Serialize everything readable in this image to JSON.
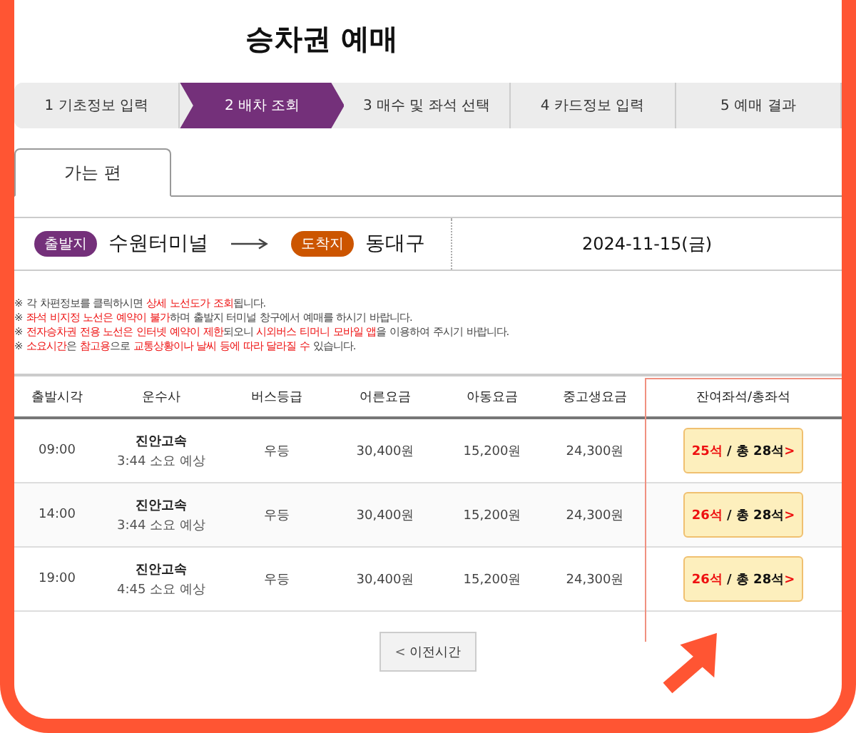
{
  "title": "승차권 예매",
  "steps": [
    {
      "label": "1 기초정보 입력",
      "selected": false
    },
    {
      "label": "2 배차 조회",
      "selected": true
    },
    {
      "label": "3 매수 및 좌석 선택",
      "selected": false
    },
    {
      "label": "4 카드정보 입력",
      "selected": false
    },
    {
      "label": "5 예매 결과",
      "selected": false
    }
  ],
  "tabs": [
    {
      "label": "가는 편",
      "selected": true
    }
  ],
  "route": {
    "departure_badge": "출발지",
    "departure": "수원터미널",
    "arrival_badge": "도착지",
    "arrival": "동대구",
    "date": "2024-11-15(금)"
  },
  "notes": [
    [
      {
        "text": "※ 각 차편정보를 클릭하시면 ",
        "red": false
      },
      {
        "text": "상세 노선도가 조회",
        "red": true
      },
      {
        "text": "됩니다.",
        "red": false
      }
    ],
    [
      {
        "text": "※ ",
        "red": false
      },
      {
        "text": "좌석 비지정 노선은 예약이 불가",
        "red": true
      },
      {
        "text": "하며 출발지 터미널 창구에서 예매를 하시기 바랍니다.",
        "red": false
      }
    ],
    [
      {
        "text": "※ ",
        "red": false
      },
      {
        "text": "전자승차권 전용 노선은 인터넷 예약이 제한",
        "red": true
      },
      {
        "text": "되오니 ",
        "red": false
      },
      {
        "text": "시외버스 티머니 모바일 앱",
        "red": true
      },
      {
        "text": "을 이용하여 주시기 바랍니다.",
        "red": false
      }
    ],
    [
      {
        "text": "※ ",
        "red": false
      },
      {
        "text": "소요시간",
        "red": true
      },
      {
        "text": "은 ",
        "red": false
      },
      {
        "text": "참고용",
        "red": true
      },
      {
        "text": "으로 ",
        "red": false
      },
      {
        "text": "교통상황이나 날씨 등에 따라 달라질 수",
        "red": true
      },
      {
        "text": " 있습니다.",
        "red": false
      }
    ]
  ],
  "table": {
    "columns": [
      "출발시각",
      "운수사",
      "버스등급",
      "어른요금",
      "아동요금",
      "중고생요금",
      "잔여좌석/총좌석"
    ],
    "rows": [
      {
        "time": "09:00",
        "company": "진안고속",
        "duration": "3:44 소요 예상",
        "grade": "우등",
        "adult": "30,400원",
        "child": "15,200원",
        "student": "24,300원",
        "remaining": "25석",
        "total": " / 총 28석",
        "chevron": ">"
      },
      {
        "time": "14:00",
        "company": "진안고속",
        "duration": "3:44 소요 예상",
        "grade": "우등",
        "adult": "30,400원",
        "child": "15,200원",
        "student": "24,300원",
        "remaining": "26석",
        "total": " / 총 28석",
        "chevron": ">"
      },
      {
        "time": "19:00",
        "company": "진안고속",
        "duration": "4:45 소요 예상",
        "grade": "우등",
        "adult": "30,400원",
        "child": "15,200원",
        "student": "24,300원",
        "remaining": "26석",
        "total": " / 총 28석",
        "chevron": ">"
      }
    ]
  },
  "prev_button": {
    "icon": "<",
    "label": "이전시간"
  }
}
